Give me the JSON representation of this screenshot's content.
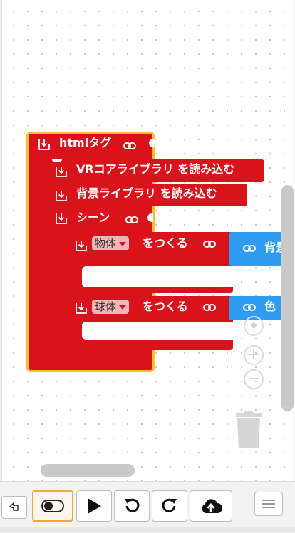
{
  "blocks": {
    "html_tag": "htmlタグ",
    "vr_core": "VRコアライブラリ を読み込む",
    "bg_lib": "背景ライブラリ を読み込む",
    "scene": "シーン",
    "create1_dropdown": "物体",
    "create1_label": "をつくる",
    "create1_value": "背景",
    "create2_dropdown": "球体",
    "create2_label": "をつくる",
    "create2_value": "色"
  },
  "zoom": {
    "in": "+",
    "out": "−"
  },
  "toolbar": {
    "items": [
      "undo-arrow",
      "toggle",
      "play",
      "undo",
      "redo",
      "upload",
      "menu"
    ]
  },
  "colors": {
    "block_red": "#d9131b",
    "block_blue": "#2e9cf3",
    "highlight": "#f8c12a"
  }
}
